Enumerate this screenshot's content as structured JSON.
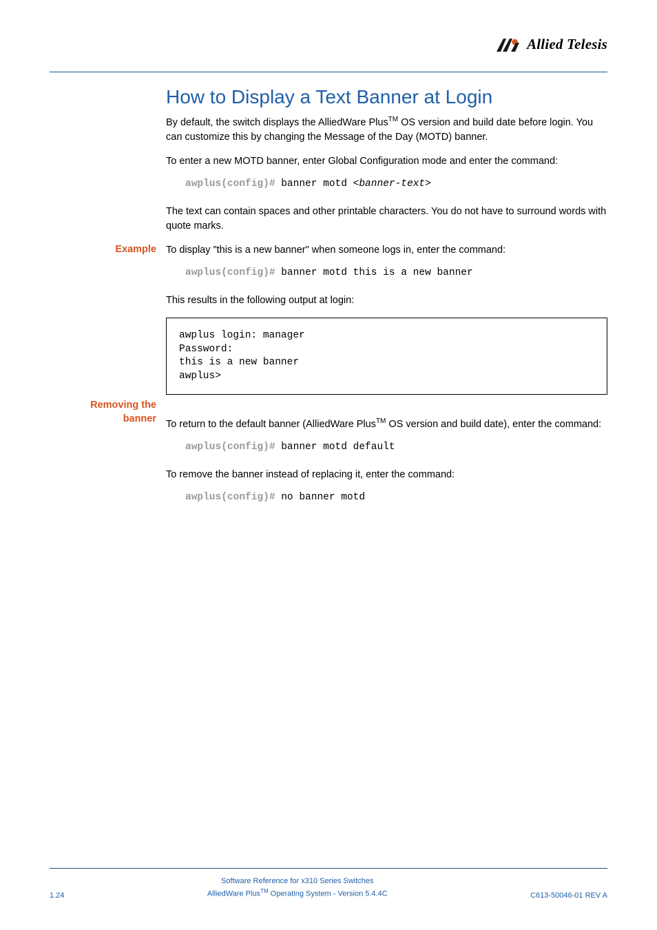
{
  "brand": "Allied Telesis",
  "heading": "How to Display a Text Banner at Login",
  "intro_para": "By default, the switch displays the AlliedWare Plus",
  "intro_para_after": " OS version and build date before login. You can customize this by changing the Message of the Day (MOTD) banner.",
  "enter_cmd_para": "To enter a new MOTD banner, enter Global Configuration mode and enter the command:",
  "prompt": "awplus(config)#",
  "cmd1_a": " banner motd <",
  "cmd1_arg": "banner-text",
  "cmd1_b": ">",
  "spaces_para": "The text can contain spaces and other printable characters. You do not have to surround words with quote marks.",
  "example_label": "Example",
  "example_para": "To display \"this is a new banner\" when someone logs in, enter the command:",
  "cmd2": " banner motd this is a new banner",
  "results_para": "This results in the following output at login:",
  "output_box": "awplus login: manager\nPassword:\nthis is a new banner\nawplus>",
  "removing_label_1": "Removing the",
  "removing_label_2": "banner",
  "removing_para_a": "To return to the default banner (AlliedWare Plus",
  "removing_para_b": " OS version and build date), enter the command:",
  "cmd3": " banner motd default",
  "remove_instead_para": "To remove the banner instead of replacing it, enter the command:",
  "cmd4": " no banner motd",
  "footer": {
    "left": "1.24",
    "center1": "Software Reference for x310 Series Switches",
    "center2a": "AlliedWare Plus",
    "center2b": " Operating System  - Version 5.4.4C",
    "right": "C613-50046-01 REV A"
  },
  "tm": "TM"
}
